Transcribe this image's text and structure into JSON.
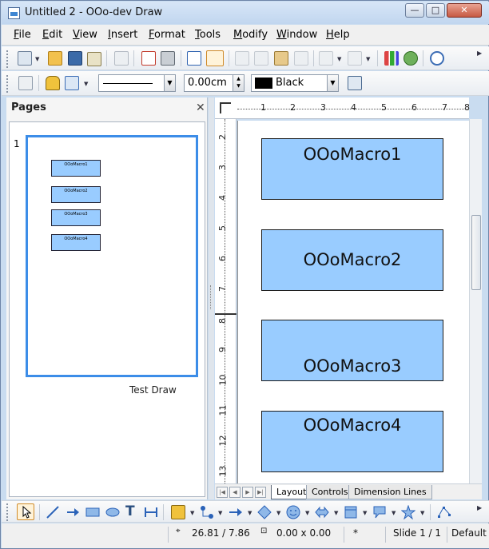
{
  "window": {
    "title": "Untitled 2 - OOo-dev Draw",
    "minimize": "—",
    "maximize": "□",
    "close": "✕"
  },
  "menu": [
    "File",
    "Edit",
    "View",
    "Insert",
    "Format",
    "Tools",
    "Modify",
    "Window",
    "Help"
  ],
  "line_props": {
    "width_value": "0.00cm",
    "color_name": "Black",
    "color_hex": "#000000"
  },
  "pages_pane": {
    "title": "Pages",
    "close": "✕",
    "page_number": "1",
    "thumbnail_shapes": [
      "OOoMacro1",
      "OOoMacro2",
      "OOoMacro3",
      "OOoMacro4"
    ],
    "label": "Test Draw"
  },
  "ruler": {
    "horizontal": [
      "1",
      "2",
      "3",
      "4",
      "5",
      "6",
      "7",
      "8"
    ],
    "vertical": [
      "2",
      "3",
      "4",
      "5",
      "6",
      "7",
      "8",
      "9",
      "10",
      "11",
      "12",
      "13"
    ]
  },
  "shapes": [
    "OOoMacro1",
    "OOoMacro2",
    "OOoMacro3",
    "OOoMacro4"
  ],
  "tabs": [
    "Layout",
    "Controls",
    "Dimension Lines"
  ],
  "status": {
    "position": "26.81 / 7.86",
    "size": "0.00 x 0.00",
    "modified": "*",
    "slide": "Slide 1 / 1",
    "master": "Default"
  },
  "colors": {
    "shape_fill": "#99ccff",
    "selection": "#3c8de8"
  }
}
